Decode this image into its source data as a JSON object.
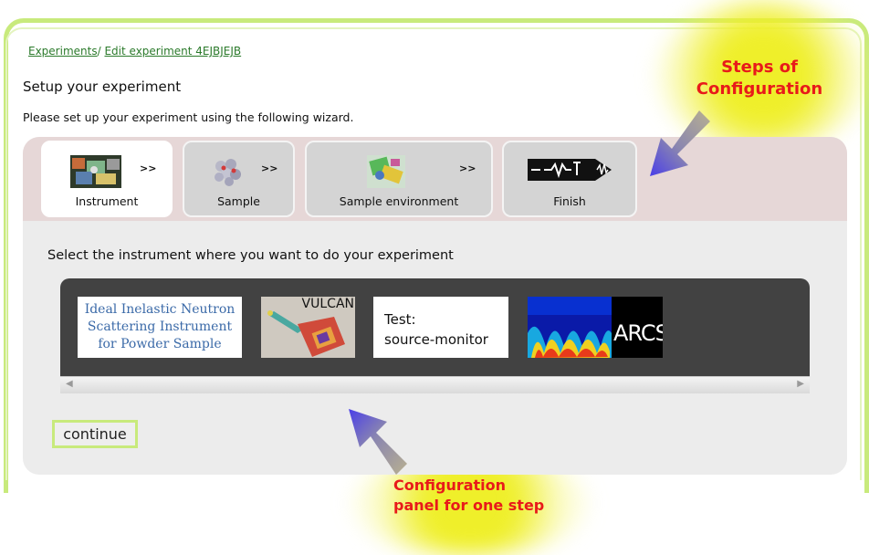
{
  "breadcrumb": {
    "experiments_link": "Experiments",
    "separator": "/",
    "edit_link": "Edit experiment 4EJBJEJB"
  },
  "header": {
    "title": "Setup your experiment",
    "intro": "Please set up your experiment using the following wizard."
  },
  "wizard": {
    "steps": [
      {
        "label": "Instrument",
        "arrow": ">>",
        "icon": "instrument-thumbnail-icon",
        "active": true
      },
      {
        "label": "Sample",
        "arrow": ">>",
        "icon": "sample-molecule-icon",
        "active": false
      },
      {
        "label": "Sample environment",
        "arrow": ">>",
        "icon": "sample-environment-icon",
        "active": false
      },
      {
        "label": "Finish",
        "arrow": "",
        "icon": "finish-logo-icon",
        "active": false
      }
    ],
    "panel_prompt": "Select the instrument where you want to do your experiment",
    "instruments": [
      {
        "name_lines": [
          "Ideal Inelastic Neutron",
          "Scattering Instrument",
          "for Powder Sample"
        ]
      },
      {
        "name": "VULCAN"
      },
      {
        "name_lines": [
          "Test:",
          "source-monitor"
        ]
      },
      {
        "name": "ARCS"
      }
    ],
    "continue_label": "continue"
  },
  "annotations": {
    "steps_line1": "Steps of",
    "steps_line2": "Configuration",
    "panel_line1": "Configuration",
    "panel_line2": "panel for one step"
  },
  "colors": {
    "frame_green": "#c8ea7c",
    "link_green": "#2b7a2b",
    "tabbar_pink": "#e6d7d7",
    "annotation_red": "#e81a1a",
    "highlight_yellow": "#f2f23a",
    "arrow_blue": "#5b4fe0"
  }
}
